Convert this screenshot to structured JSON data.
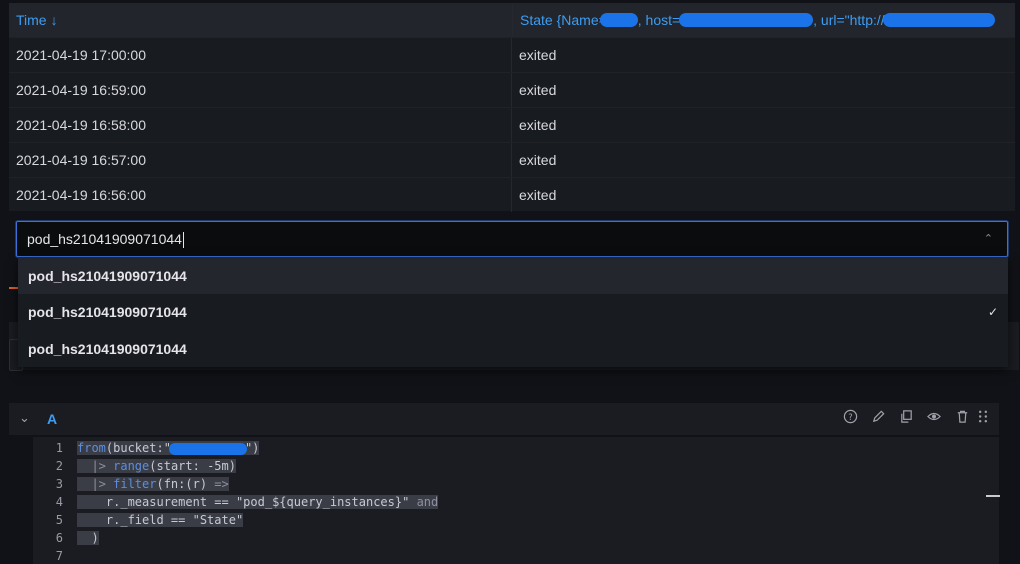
{
  "table": {
    "col_time": "Time",
    "sort_arrow": "↓",
    "col_state_a": "State {Name=\"",
    "col_state_b": ", host=\"",
    "col_state_c": ", url=\"http://",
    "rows": [
      {
        "time": "2021-04-19 17:00:00",
        "state": "exited"
      },
      {
        "time": "2021-04-19 16:59:00",
        "state": "exited"
      },
      {
        "time": "2021-04-19 16:58:00",
        "state": "exited"
      },
      {
        "time": "2021-04-19 16:57:00",
        "state": "exited"
      },
      {
        "time": "2021-04-19 16:56:00",
        "state": "exited"
      }
    ]
  },
  "select": {
    "value": "pod_hs21041909071044",
    "chevron": "⌃",
    "options": [
      {
        "label": "pod_hs21041909071044",
        "checked": false
      },
      {
        "label": "pod_hs21041909071044",
        "checked": true
      },
      {
        "label": "pod_hs21041909071044",
        "checked": false
      }
    ],
    "check_glyph": "✓"
  },
  "query": {
    "toggle": "⌄",
    "ref_id": "A",
    "icons": [
      "help-icon",
      "edit-icon",
      "duplicate-icon",
      "eye-icon",
      "trash-icon",
      "drag-icon"
    ]
  },
  "editor": {
    "line_numbers": [
      "1",
      "2",
      "3",
      "4",
      "5",
      "6",
      "7"
    ],
    "l1_kw": "from",
    "l1_rest": "(bucket:\"",
    "l1_end": "\")",
    "l2_pipe": "  |>",
    "l2_kw": " range",
    "l2_rest": "(start: -5m)",
    "l3_pipe": "  |>",
    "l3_kw": " filter",
    "l3_rest": "(fn:(r) ",
    "l3_arrow": "=>",
    "l4_code": "    r._measurement == \"pod_${query_instances}\"",
    "l4_and": " and",
    "l5_code": "    r._field == \"State\"",
    "l6_code": "  )"
  },
  "colors": {
    "accent": "#3d9df2",
    "redact": "#1a73e8",
    "focus_border": "#3d71d9"
  }
}
